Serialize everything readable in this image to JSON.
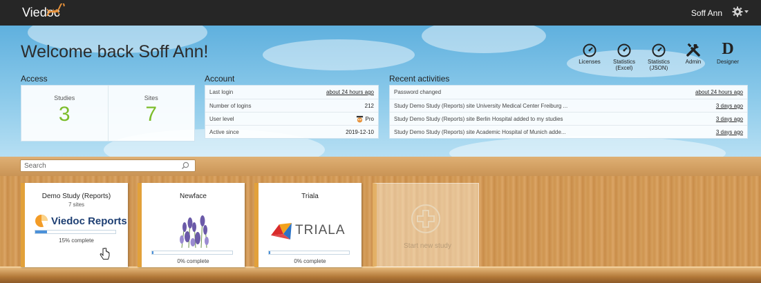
{
  "topbar": {
    "brand": "Viedoc",
    "user_name": "Soff Ann"
  },
  "header": {
    "welcome": "Welcome back Soff Ann!"
  },
  "quick_links": [
    {
      "label": "Licenses",
      "icon": "speedometer-icon"
    },
    {
      "label": "Statistics (Excel)",
      "icon": "speedometer-icon"
    },
    {
      "label": "Statistics (JSON)",
      "icon": "speedometer-icon"
    },
    {
      "label": "Admin",
      "icon": "tools-icon"
    },
    {
      "label": "Designer",
      "icon": "designer-d-icon"
    }
  ],
  "access": {
    "title": "Access",
    "studies_label": "Studies",
    "studies_count": "3",
    "sites_label": "Sites",
    "sites_count": "7"
  },
  "account": {
    "title": "Account",
    "rows": [
      {
        "label": "Last login",
        "value": "about 24 hours ago"
      },
      {
        "label": "Number of logins",
        "value": "212"
      },
      {
        "label": "User level",
        "value": "Pro"
      },
      {
        "label": "Active since",
        "value": "2019-12-10"
      }
    ]
  },
  "recent": {
    "title": "Recent activities",
    "rows": [
      {
        "text": "Password changed",
        "time": "about 24 hours ago"
      },
      {
        "text": "Study Demo Study (Reports) site University Medical Center Freiburg ...",
        "time": "3 days ago"
      },
      {
        "text": "Study Demo Study (Reports) site Berlin Hospital added to my studies",
        "time": "3 days ago"
      },
      {
        "text": "Study Demo Study (Reports) site Academic Hospital of Munich adde...",
        "time": "3 days ago"
      }
    ]
  },
  "search": {
    "placeholder": "Search"
  },
  "studies": [
    {
      "title": "Demo Study (Reports)",
      "sites": "7 sites",
      "logo_text": "Viedoc Reports",
      "progress": 0.15,
      "progress_label": "15% complete"
    },
    {
      "title": "Newface",
      "progress": 0.0,
      "progress_label": "0% complete"
    },
    {
      "title": "Triala",
      "logo_text": "TRIALA",
      "progress": 0.0,
      "progress_label": "0% complete"
    }
  ],
  "new_study": {
    "label": "Start new study"
  },
  "colors": {
    "accent_green": "#7cbd2b",
    "progress_blue": "#4a90d9",
    "card_spine": "#e2a13a",
    "topbar": "#262626"
  }
}
